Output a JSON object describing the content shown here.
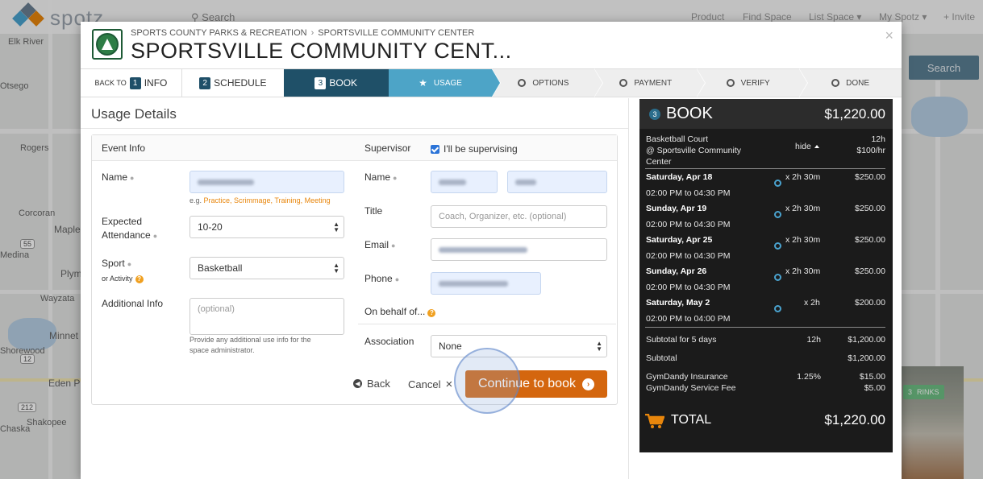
{
  "background": {
    "logo_text": "spotz",
    "search_label": "Search",
    "nav": [
      "Product",
      "Find Space",
      "List Space",
      "My Spotz",
      "Invite"
    ],
    "search_button": "Search",
    "map_places": [
      "Elk River",
      "Otsego",
      "Rogers",
      "Corcoran",
      "Maple",
      "Medina",
      "Plym",
      "Wayzata",
      "Minnet",
      "Shorewood",
      "Eden P",
      "Shakopee",
      "Chaska"
    ],
    "route_shields": [
      "55",
      "12",
      "212"
    ],
    "rinks_badge_num": "3",
    "rinks_badge_label": "RINKS"
  },
  "header": {
    "crumb_org": "SPORTS COUNTY PARKS & RECREATION",
    "crumb_sep": "›",
    "crumb_place": "SPORTSVILLE COMMUNITY CENTER",
    "title": "SPORTSVILLE COMMUNITY CENT...",
    "close": "×"
  },
  "steps": {
    "info": {
      "pre": "BACK TO",
      "num": "1",
      "label": "INFO"
    },
    "schedule": {
      "num": "2",
      "label": "SCHEDULE"
    },
    "book": {
      "num": "3",
      "label": "BOOK"
    },
    "sub": [
      "USAGE",
      "OPTIONS",
      "PAYMENT",
      "VERIFY",
      "DONE"
    ]
  },
  "usage": {
    "section_title": "Usage Details",
    "event_info_label": "Event Info",
    "supervisor_label": "Supervisor",
    "supervising_label": "I'll be supervising",
    "name_label": "Name",
    "name_hint_prefix": "e.g.",
    "name_hint_examples": "Practice, Scrimmage, Training, Meeting",
    "expected_label_1": "Expected",
    "expected_label_2": "Attendance",
    "attendance_value": "10-20",
    "sport_label": "Sport",
    "sport_sub": "or Activity",
    "sport_value": "Basketball",
    "additional_label": "Additional Info",
    "additional_placeholder": "(optional)",
    "additional_hint_1": "Provide any additional use info for the",
    "additional_hint_2": "space administrator.",
    "sup_name_label": "Name",
    "title_label": "Title",
    "title_placeholder": "Coach, Organizer, etc. (optional)",
    "email_label": "Email",
    "phone_label": "Phone",
    "behalf_label": "On behalf of...",
    "association_label": "Association",
    "association_value": "None",
    "back_label": "Back",
    "cancel_label": "Cancel",
    "cancel_icon": "×",
    "continue_label": "Continue to book"
  },
  "booking": {
    "step_num": "3",
    "title": "BOOK",
    "total_header": "$1,220.00",
    "item_line1": "Basketball Court",
    "item_line2": "@ Sportsville Community",
    "item_line3": "Center",
    "hide_label": "hide",
    "hours": "12h",
    "rate": "$100/hr",
    "sessions": [
      {
        "date": "Saturday, Apr 18",
        "time": "02:00 PM to 04:30 PM",
        "dur": "x 2h 30m",
        "price": "$250.00"
      },
      {
        "date": "Sunday, Apr 19",
        "time": "02:00 PM to 04:30 PM",
        "dur": "x 2h 30m",
        "price": "$250.00"
      },
      {
        "date": "Saturday, Apr 25",
        "time": "02:00 PM to 04:30 PM",
        "dur": "x 2h 30m",
        "price": "$250.00"
      },
      {
        "date": "Sunday, Apr 26",
        "time": "02:00 PM to 04:30 PM",
        "dur": "x 2h 30m",
        "price": "$250.00"
      },
      {
        "date": "Saturday, May 2",
        "time": "02:00 PM to 04:00 PM",
        "dur": "x 2h",
        "price": "$200.00"
      }
    ],
    "subtotal_days_label": "Subtotal for 5 days",
    "subtotal_days_hours": "12h",
    "subtotal_days_amount": "$1,200.00",
    "subtotal_label": "Subtotal",
    "subtotal_amount": "$1,200.00",
    "insurance_label": "GymDandy Insurance",
    "insurance_pct": "1.25%",
    "insurance_amount": "$15.00",
    "service_label": "GymDandy Service Fee",
    "service_amount": "$5.00",
    "total_label": "TOTAL",
    "total_amount": "$1,220.00"
  },
  "colors": {
    "brand_teal": "#1f5068",
    "accent_blue": "#4da4c7",
    "continue_orange": "#d4660e",
    "panel_dark": "#1b1b1b"
  }
}
